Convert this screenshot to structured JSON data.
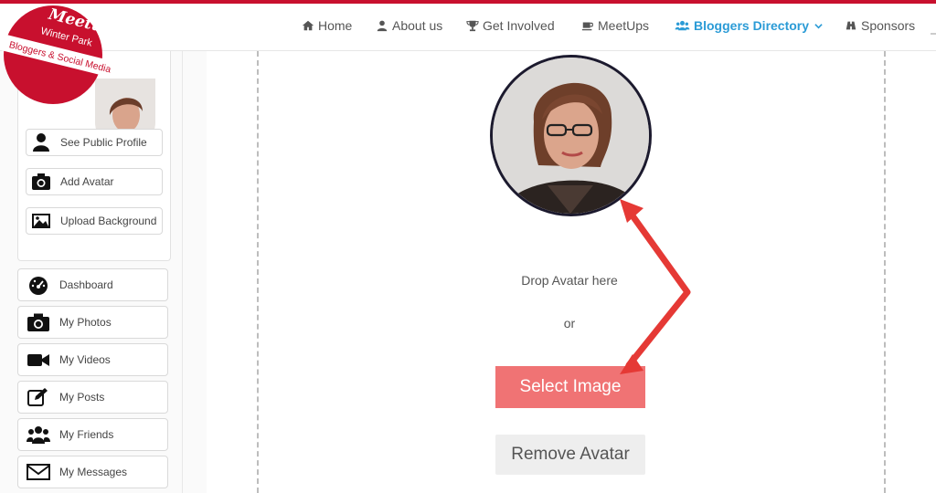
{
  "logo": {
    "brand": "Meetup",
    "line1": "Winter Park",
    "line2": "Bloggers & Social Media"
  },
  "nav": {
    "items": [
      {
        "label": "Home",
        "icon": "home-icon"
      },
      {
        "label": "About us",
        "icon": "user-icon"
      },
      {
        "label": "Get Involved",
        "icon": "trophy-icon"
      },
      {
        "label": "MeetUps",
        "icon": "coffee-icon"
      },
      {
        "label": "Bloggers Directory",
        "icon": "users-icon",
        "active": true
      },
      {
        "label": "Sponsors",
        "icon": "binoculars-icon"
      }
    ],
    "accent": "#2b9bd6"
  },
  "profile_actions": [
    {
      "label": "See Public Profile",
      "icon": "user-icon"
    },
    {
      "label": "Add Avatar",
      "icon": "camera-icon"
    },
    {
      "label": "Upload Background",
      "icon": "image-icon"
    }
  ],
  "menu": [
    {
      "label": "Dashboard",
      "icon": "dashboard-icon"
    },
    {
      "label": "My Photos",
      "icon": "camera-icon"
    },
    {
      "label": "My Videos",
      "icon": "video-icon"
    },
    {
      "label": "My Posts",
      "icon": "edit-icon"
    },
    {
      "label": "My Friends",
      "icon": "users-icon"
    },
    {
      "label": "My Messages",
      "icon": "envelope-icon"
    }
  ],
  "upload": {
    "drop_text": "Drop Avatar here",
    "or_text": "or",
    "select_label": "Select Image",
    "remove_label": "Remove Avatar"
  },
  "colors": {
    "brand_red": "#c8102e",
    "select_button": "#f07374",
    "arrow": "#e53935"
  }
}
